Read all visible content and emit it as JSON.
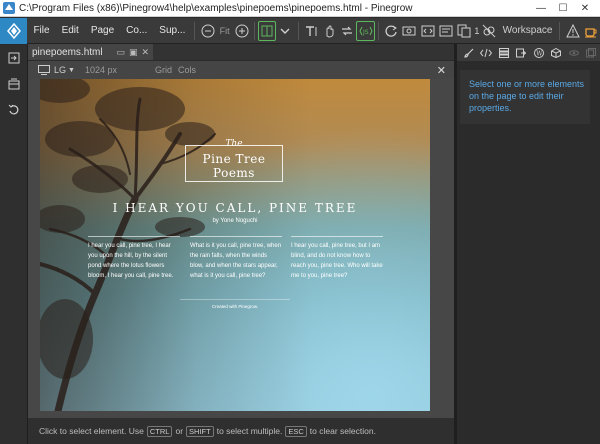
{
  "window": {
    "title": "C:\\Program Files (x86)\\Pinegrow4\\help\\examples\\pinepoems\\pinepoems.html - Pinegrow",
    "minimize": "—",
    "maximize": "☐",
    "close": "✕"
  },
  "menu": {
    "items": [
      "File",
      "Edit",
      "Page",
      "Co...",
      "Sup..."
    ]
  },
  "toolbar": {
    "fit_label": "Fit",
    "counter": "1",
    "workspace_label": "Workspace"
  },
  "document": {
    "tab_name": "pinepoems.html"
  },
  "canvas": {
    "device": "LG",
    "width": "1024 px",
    "grid_label": "Grid",
    "cols_label": "Cols"
  },
  "page": {
    "the": "The",
    "logo_line1": "Pine Tree",
    "logo_line2": "Poems",
    "headline": "I HEAR YOU CALL, PINE TREE",
    "byline": "by Yone Noguchi",
    "columns": [
      "I hear you call, pine tree, I hear you upon the hill, by the silent pond where the lotus flowers bloom, I hear you call, pine tree.",
      "What is it you call, pine tree, when the rain falls, when the winds blow, and when the stars appear, what is it you call, pine tree?",
      "I hear you call, pine tree, but I am blind, and do not know how to reach you, pine tree. Who will take me to you, pine tree?"
    ],
    "credit": "Created with Pinegrow."
  },
  "properties_panel": {
    "message": "Select one or more elements on the page to edit their properties."
  },
  "statusbar": {
    "part1": "Click to select element. Use",
    "key1": "CTRL",
    "part2": "or",
    "key2": "SHIFT",
    "part3": "to select multiple.",
    "key3": "ESC",
    "part4": "to clear selection."
  },
  "colors": {
    "accent_blue": "#2e88c4",
    "panel_text_blue": "#5aa9e6",
    "active_green": "#5cb85c",
    "orange_icon": "#f0a23a"
  }
}
